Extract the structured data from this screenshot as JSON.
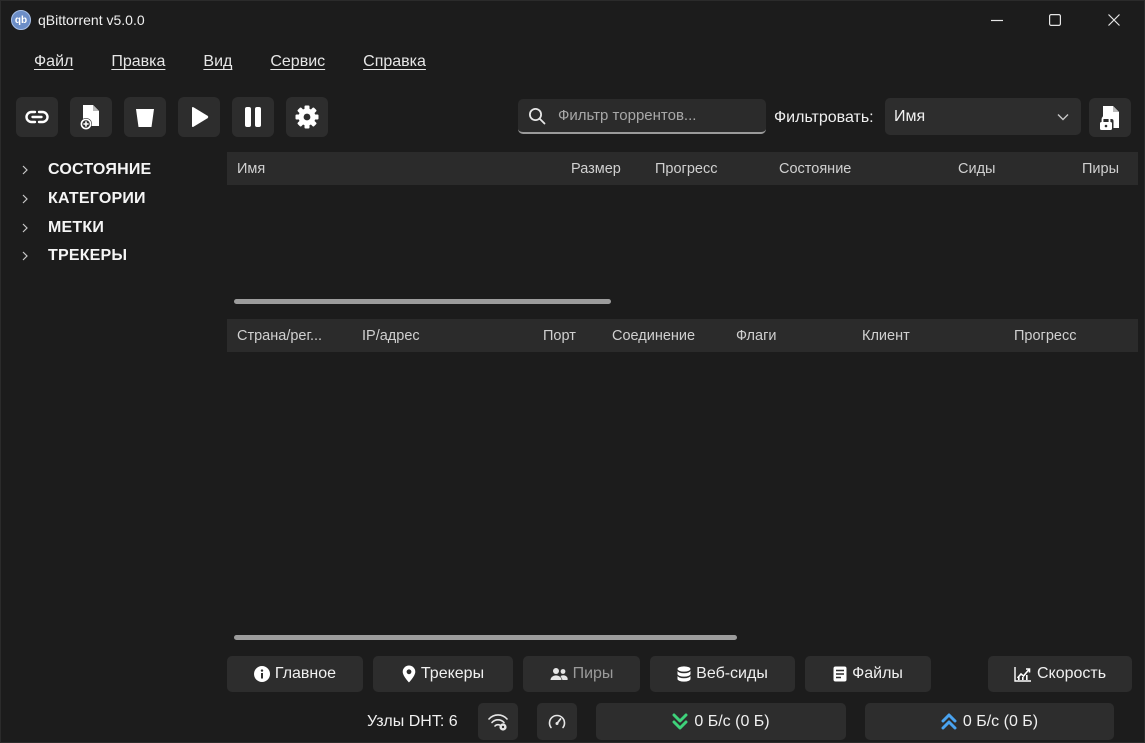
{
  "window": {
    "title": "qBittorrent v5.0.0",
    "app_icon_text": "qb"
  },
  "menu": [
    {
      "label": "Файл"
    },
    {
      "label": "Правка"
    },
    {
      "label": "Вид"
    },
    {
      "label": "Сервис"
    },
    {
      "label": "Справка"
    }
  ],
  "toolbar": {
    "search_placeholder": "Фильтр торрентов...",
    "filter_label": "Фильтровать:",
    "filter_value": "Имя"
  },
  "sidebar": {
    "items": [
      {
        "label": "СОСТОЯНИЕ"
      },
      {
        "label": "КАТЕГОРИИ"
      },
      {
        "label": "МЕТКИ"
      },
      {
        "label": "ТРЕКЕРЫ"
      }
    ]
  },
  "torrent_table": {
    "columns": [
      "Имя",
      "Размер",
      "Прогресс",
      "Состояние",
      "Сиды",
      "Пиры"
    ]
  },
  "peer_table": {
    "columns": [
      "Страна/рег...",
      "IP/адрес",
      "Порт",
      "Соединение",
      "Флаги",
      "Клиент",
      "Прогресс"
    ]
  },
  "tabs": {
    "general": "Главное",
    "trackers": "Трекеры",
    "peers": "Пиры",
    "webseeds": "Веб-сиды",
    "files": "Файлы",
    "speed": "Скорость"
  },
  "status": {
    "dht": "Узлы DHT: 6",
    "download": "0 Б/с (0 Б)",
    "upload": "0 Б/с (0 Б)"
  },
  "colors": {
    "download_accent": "#3ed27a",
    "upload_accent": "#4aa3f0"
  }
}
